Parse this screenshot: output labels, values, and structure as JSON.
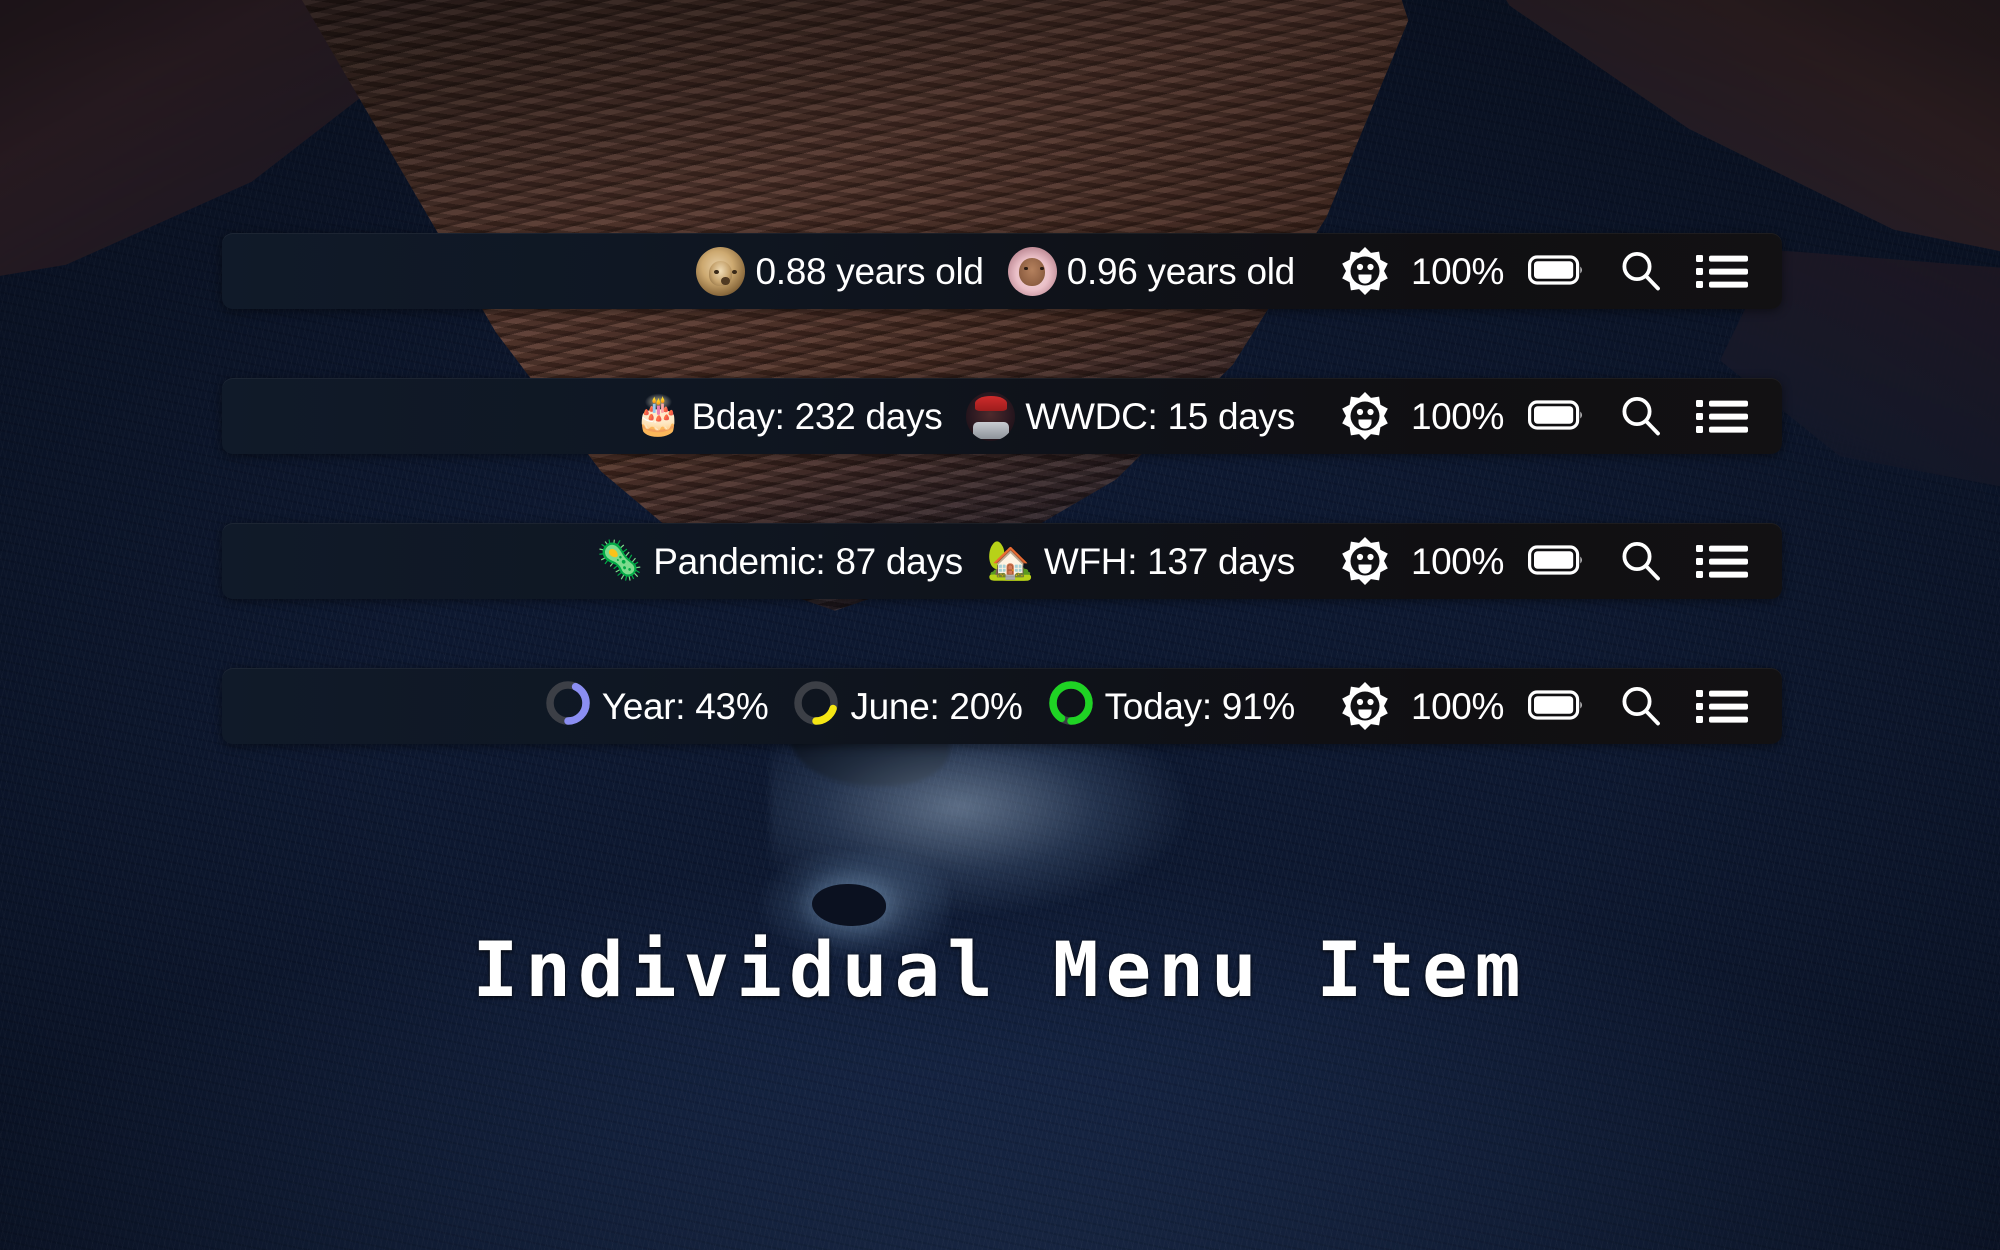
{
  "wallpaper": {
    "name": "macos-big-sur-coastline"
  },
  "caption": {
    "text": "Individual Menu Item"
  },
  "status_cluster": {
    "memoji_icon": "memoji-sticker-icon",
    "battery_percent": "100%",
    "battery_icon": "battery-full-icon",
    "search_icon": "search-icon",
    "list_icon": "list-menu-icon"
  },
  "bars": [
    {
      "name": "menu-bar-ages",
      "items": [
        {
          "icon": "dog-avatar",
          "icon_kind": "avatar",
          "avatar_class": "av-dog",
          "label": "0.88 years old"
        },
        {
          "icon": "baby-avatar",
          "icon_kind": "avatar",
          "avatar_class": "av-baby",
          "label": "0.96 years old"
        }
      ]
    },
    {
      "name": "menu-bar-countdowns",
      "items": [
        {
          "icon": "birthday-cake-emoji",
          "icon_kind": "emoji",
          "glyph": "🎂",
          "label": "Bday: 232 days"
        },
        {
          "icon": "wwdc-memoji-avatar",
          "icon_kind": "avatar",
          "avatar_class": "av-wwdc",
          "label": "WWDC: 15 days"
        }
      ]
    },
    {
      "name": "menu-bar-elapsed",
      "items": [
        {
          "icon": "virus-emoji",
          "icon_kind": "emoji",
          "glyph": "🦠",
          "label": "Pandemic: 87 days"
        },
        {
          "icon": "house-with-garden-emoji",
          "icon_kind": "emoji",
          "glyph": "🏡",
          "label": "WFH: 137 days"
        }
      ]
    },
    {
      "name": "menu-bar-progress",
      "items": [
        {
          "icon": "progress-ring-year",
          "icon_kind": "ring",
          "label": "Year: 43%",
          "percent": 43,
          "color": "#8b8ef2",
          "track": "#3c3f46"
        },
        {
          "icon": "progress-ring-june",
          "icon_kind": "ring",
          "label": "June: 20%",
          "percent": 20,
          "color": "#f5e614",
          "track": "#3c3f46"
        },
        {
          "icon": "progress-ring-today",
          "icon_kind": "ring",
          "label": "Today: 91%",
          "percent": 91,
          "color": "#1fd324",
          "track": "#3c3f46"
        }
      ]
    }
  ]
}
